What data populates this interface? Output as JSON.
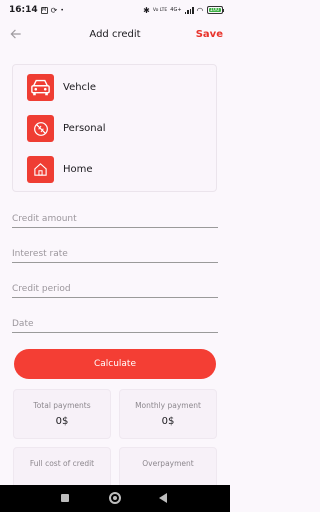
{
  "status_bar": {
    "time": "16:14",
    "notification_icon": "M",
    "right_text": "Vo LTE",
    "network": "4G+",
    "battery_text": "100"
  },
  "header": {
    "title": "Add credit",
    "save_label": "Save"
  },
  "categories": [
    {
      "label": "Vehcle",
      "icon": "car-icon"
    },
    {
      "label": "Personal",
      "icon": "personal-icon"
    },
    {
      "label": "Home",
      "icon": "home-icon"
    }
  ],
  "fields": {
    "credit_amount": {
      "placeholder": "Credit amount",
      "value": ""
    },
    "interest_rate": {
      "placeholder": "Interest rate",
      "value": ""
    },
    "credit_period": {
      "placeholder": "Credit period",
      "value": ""
    },
    "date": {
      "placeholder": "Date",
      "value": ""
    }
  },
  "calculate_label": "Calculate",
  "results": {
    "total_payments": {
      "label": "Total payments",
      "value": "0$"
    },
    "monthly_payment": {
      "label": "Monthly payment",
      "value": "0$"
    },
    "full_cost": {
      "label": "Full cost of credit"
    },
    "overpayment": {
      "label": "Overpayment"
    }
  },
  "colors": {
    "accent": "#f43e34",
    "background": "#fbf7fc"
  }
}
